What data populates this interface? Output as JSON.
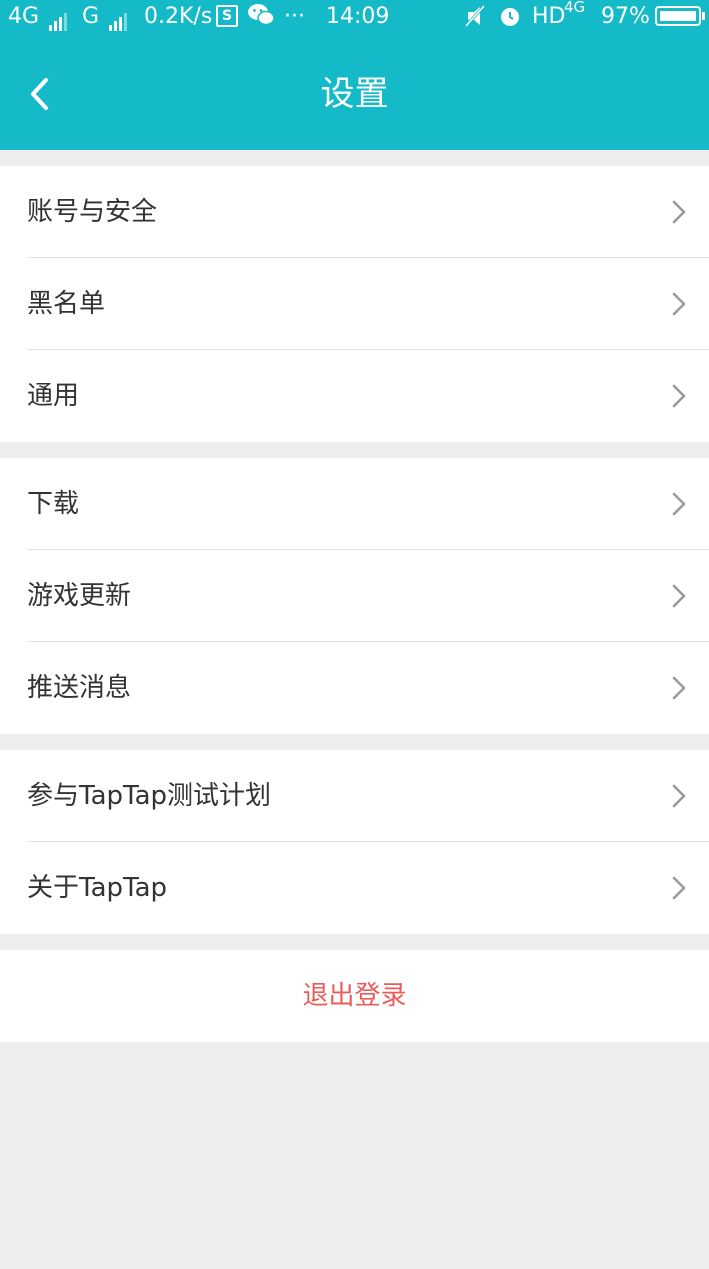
{
  "status_bar": {
    "network1": "4G",
    "network2": "G",
    "speed": "0.2K/s",
    "s_badge": "S",
    "dots": "···",
    "time": "14:09",
    "hd": "HD",
    "net_small": "4G",
    "battery": "97%"
  },
  "header": {
    "title": "设置",
    "bg_color": "#14bac7"
  },
  "groups": [
    {
      "items": [
        "账号与安全",
        "黑名单",
        "通用"
      ]
    },
    {
      "items": [
        "下载",
        "游戏更新",
        "推送消息"
      ]
    },
    {
      "items": [
        "参与TapTap测试计划",
        "关于TapTap"
      ]
    }
  ],
  "logout": {
    "label": "退出登录",
    "color": "#ec5b5b"
  }
}
